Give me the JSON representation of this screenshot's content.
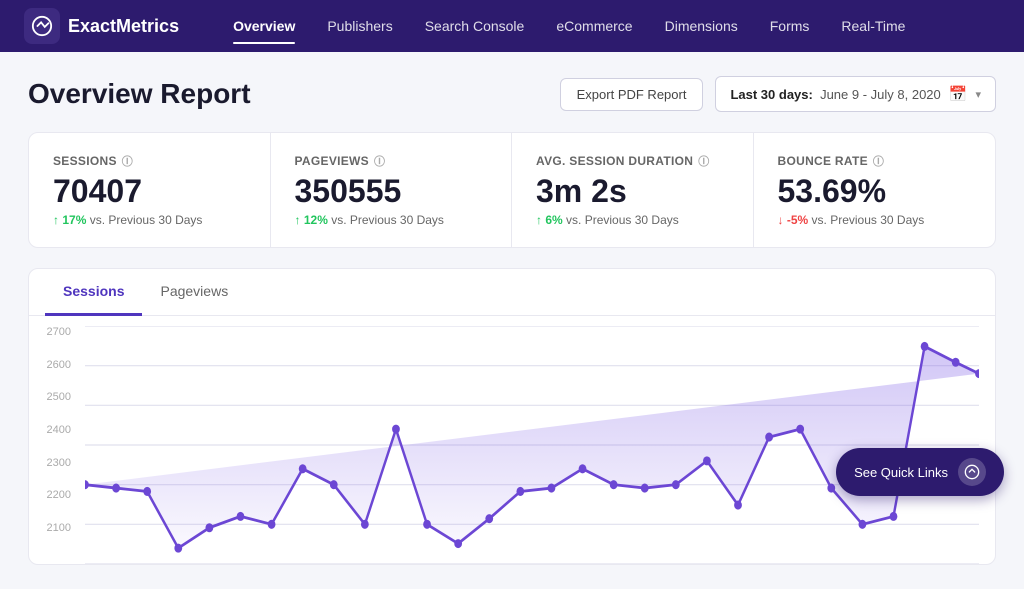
{
  "brand": {
    "logo_text": "Exact",
    "logo_text2": "Metrics"
  },
  "nav": {
    "links": [
      {
        "label": "Overview",
        "active": true
      },
      {
        "label": "Publishers",
        "active": false
      },
      {
        "label": "Search Console",
        "active": false
      },
      {
        "label": "eCommerce",
        "active": false
      },
      {
        "label": "Dimensions",
        "active": false
      },
      {
        "label": "Forms",
        "active": false
      },
      {
        "label": "Real-Time",
        "active": false
      }
    ]
  },
  "page": {
    "title": "Overview Report",
    "export_label": "Export PDF Report",
    "date_range_prefix": "Last 30 days:",
    "date_range_value": "June 9 - July 8, 2020"
  },
  "stats": [
    {
      "label": "Sessions",
      "value": "70407",
      "change_pct": "17%",
      "change_dir": "up",
      "change_label": "vs. Previous 30 Days"
    },
    {
      "label": "Pageviews",
      "value": "350555",
      "change_pct": "12%",
      "change_dir": "up",
      "change_label": "vs. Previous 30 Days"
    },
    {
      "label": "Avg. Session Duration",
      "value": "3m 2s",
      "change_pct": "6%",
      "change_dir": "up",
      "change_label": "vs. Previous 30 Days"
    },
    {
      "label": "Bounce Rate",
      "value": "53.69%",
      "change_pct": "-5%",
      "change_dir": "down",
      "change_label": "vs. Previous 30 Days"
    }
  ],
  "chart": {
    "tabs": [
      "Sessions",
      "Pageviews"
    ],
    "active_tab": "Sessions",
    "y_labels": [
      "2700",
      "2600",
      "2500",
      "2400",
      "2300",
      "2200",
      "2100"
    ],
    "quick_links_label": "See Quick Links"
  }
}
